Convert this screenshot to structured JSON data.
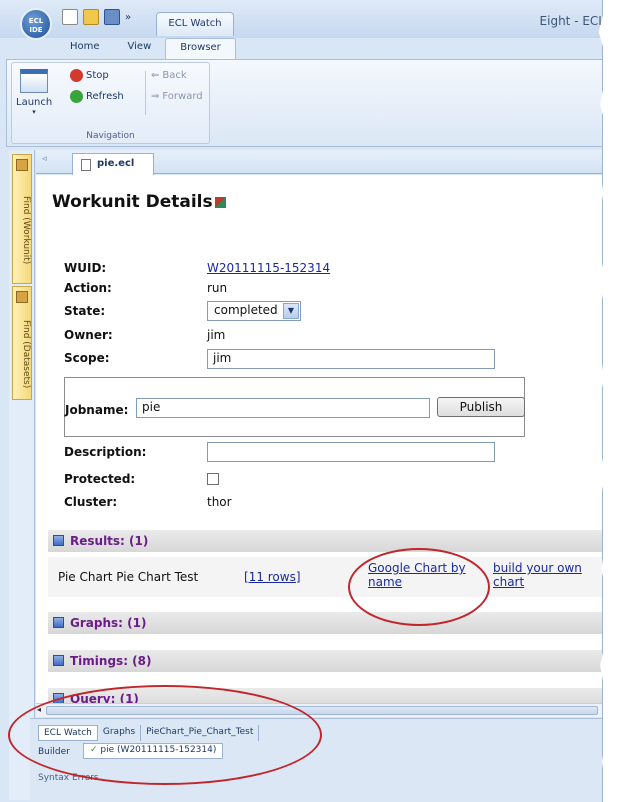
{
  "app": {
    "logo_text": "ECL IDE",
    "doc_tab": "ECL Watch",
    "window_title": "Eight - ECL"
  },
  "ribbon": {
    "tabs": [
      "Home",
      "View",
      "Browser"
    ],
    "active_tab": "Browser",
    "launch_label": "Launch",
    "stop_label": "Stop",
    "refresh_label": "Refresh",
    "back_label": "Back",
    "forward_label": "Forward",
    "group_label": "Navigation"
  },
  "side_panels": [
    "Find (Workunit)",
    "Find (Datasets)"
  ],
  "editor_tab": "pie.ecl",
  "workunit": {
    "heading": "Workunit Details",
    "wuid_label": "WUID:",
    "wuid_value": "W20111115-152314",
    "action_label": "Action:",
    "action_value": "run",
    "state_label": "State:",
    "state_value": "completed",
    "owner_label": "Owner:",
    "owner_value": "jim",
    "scope_label": "Scope:",
    "scope_value": "jim",
    "jobname_label": "Jobname:",
    "jobname_value": "pie",
    "publish_label": "Publish",
    "description_label": "Description:",
    "description_value": "",
    "protected_label": "Protected:",
    "cluster_label": "Cluster:",
    "cluster_value": "thor"
  },
  "sections": {
    "results": "Results: (1)",
    "graphs": "Graphs: (1)",
    "timings": "Timings: (8)",
    "query": "Query: (1)"
  },
  "result_row": {
    "name": "Pie Chart Pie Chart Test",
    "rows_link": "[11 rows]",
    "google_link_line1": "Google Chart by",
    "google_link_line2": "name",
    "build_link_line1": "build your own",
    "build_link_line2": "chart"
  },
  "bottom": {
    "tabs": [
      "ECL Watch",
      "Graphs",
      "PieChart_Pie_Chart_Test"
    ],
    "builder_label": "Builder",
    "builder_result": "pie (W20111115-152314)",
    "syntax_label": "Syntax Errors"
  },
  "colors": {
    "annotation": "#c0272d",
    "section_text": "#6b1d87",
    "link": "#1a2a9e"
  }
}
